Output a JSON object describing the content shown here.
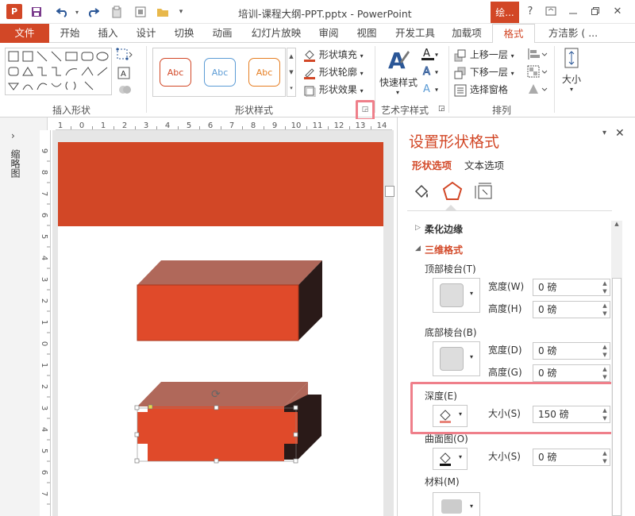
{
  "window": {
    "title": "培训-课程大纲-PPT.pptx - PowerPoint",
    "app_icon": "P",
    "drawing_tools_tab": "绘...",
    "help": "?",
    "close": "✕"
  },
  "tabs": {
    "file": "文件",
    "items": [
      "开始",
      "插入",
      "设计",
      "切换",
      "动画",
      "幻灯片放映",
      "审阅",
      "视图",
      "开发工具",
      "加载项",
      "格式"
    ],
    "user": "方洁影 ( ..."
  },
  "ribbon": {
    "insert_shapes_label": "插入形状",
    "shape_styles_label": "形状样式",
    "wordart_label": "艺术字样式",
    "arrange_label": "排列",
    "style_samples": [
      "Abc",
      "Abc",
      "Abc"
    ],
    "shape_fill": "形状填充",
    "shape_outline": "形状轮廓",
    "shape_effects": "形状效果",
    "quick_styles": "快速样式",
    "bring_forward": "上移一层",
    "send_backward": "下移一层",
    "selection_pane": "选择窗格",
    "size": "大小"
  },
  "thumbnails_label": "缩略图",
  "ruler": {
    "h": [
      "1",
      "0",
      "1",
      "2",
      "3",
      "4",
      "5",
      "6",
      "7",
      "8",
      "9",
      "10",
      "11",
      "12",
      "13",
      "14"
    ],
    "v": [
      "9",
      "8",
      "7",
      "6",
      "5",
      "4",
      "3",
      "2",
      "1",
      "0",
      "1",
      "2",
      "3",
      "4",
      "5",
      "6",
      "7"
    ]
  },
  "panel": {
    "title": "设置形状格式",
    "tab_shape": "形状选项",
    "tab_text": "文本选项",
    "soft_edges": "柔化边缘",
    "format3d": "三维格式",
    "top_bevel": "顶部棱台(T)",
    "bottom_bevel": "底部棱台(B)",
    "width_label": "宽度(W)",
    "height_label": "高度(H)",
    "width_label_b": "宽度(D)",
    "height_label_b": "高度(G)",
    "top_width": "0 磅",
    "top_height": "0 磅",
    "bottom_width": "0 磅",
    "bottom_height": "0 磅",
    "depth": "深度(E)",
    "depth_size_label": "大小(S)",
    "depth_size": "150 磅",
    "contour": "曲面图(O)",
    "contour_size_label": "大小(S)",
    "contour_size": "0 磅",
    "material": "材料(M)"
  },
  "colors": {
    "accent": "#d24726",
    "shape": "#e04a2a",
    "shape_top": "#b0685a",
    "shape_side": "#2a1a18"
  }
}
